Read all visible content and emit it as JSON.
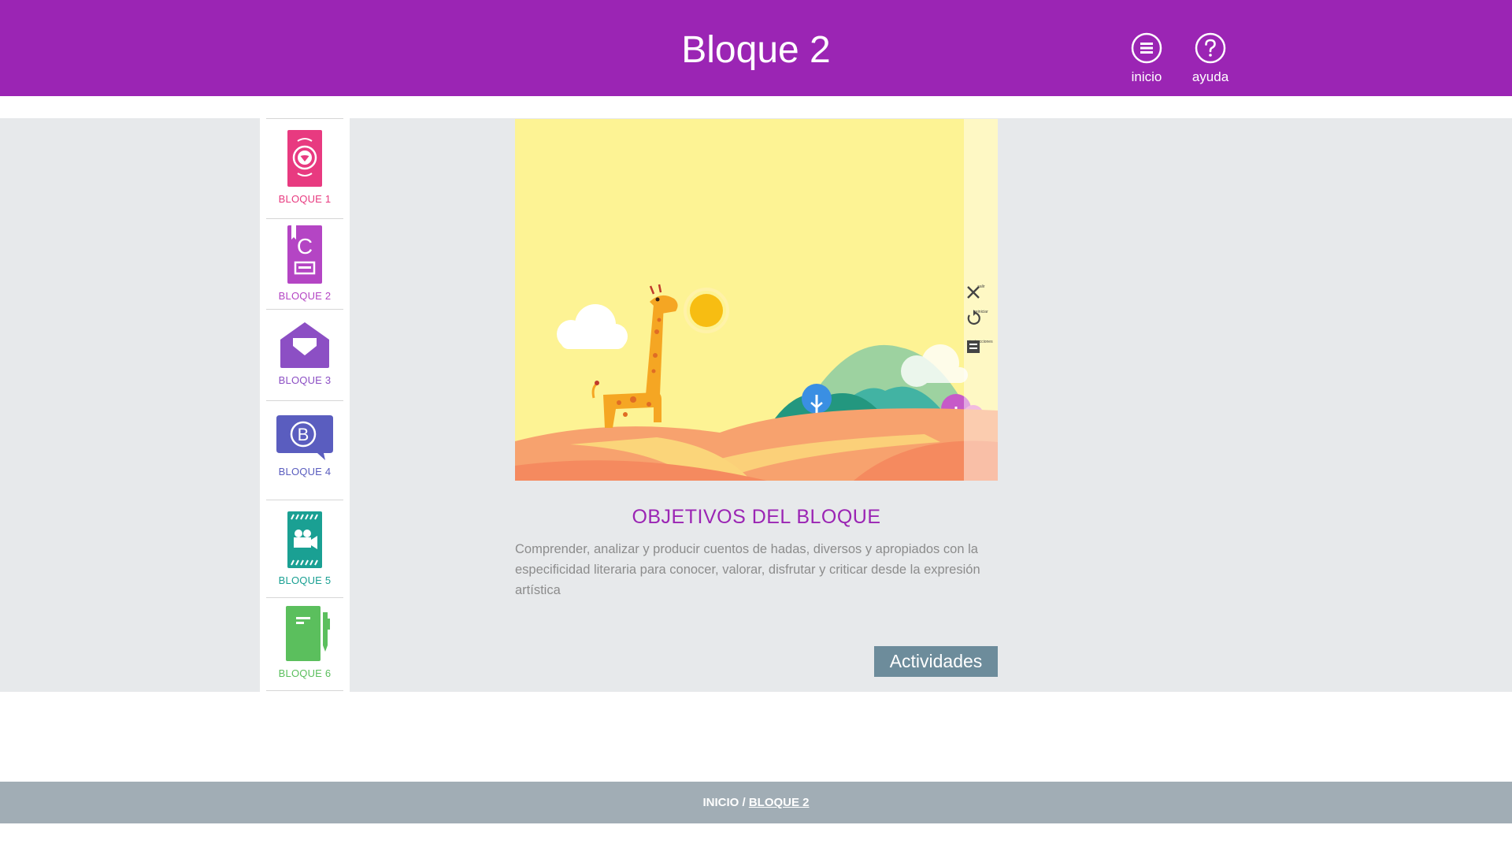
{
  "header": {
    "title": "Bloque 2",
    "nav": [
      {
        "label": "inicio",
        "icon": "menu-icon"
      },
      {
        "label": "ayuda",
        "icon": "help-icon"
      }
    ]
  },
  "sidebar": {
    "items": [
      {
        "label": "BLOQUE 1",
        "icon": "phone-heart-icon",
        "color": "#e83a80"
      },
      {
        "label": "BLOQUE 2",
        "icon": "letter-book-icon",
        "color": "#b445c4"
      },
      {
        "label": "BLOQUE 3",
        "icon": "envelope-heart-icon",
        "color": "#8c4fc4"
      },
      {
        "label": "BLOQUE 4",
        "icon": "chat-bubble-b-icon",
        "color": "#5a5dbf"
      },
      {
        "label": "BLOQUE 5",
        "icon": "film-camera-icon",
        "color": "#1aa093"
      },
      {
        "label": "BLOQUE 6",
        "icon": "notebook-pen-icon",
        "color": "#5bbf5d"
      }
    ]
  },
  "illustration": {
    "controls": [
      {
        "label": "salir",
        "icon": "close-icon"
      },
      {
        "label": "reiniciar",
        "icon": "restart-icon"
      },
      {
        "label": "instrucciones",
        "icon": "list-icon"
      }
    ]
  },
  "objectives": {
    "title": "OBJETIVOS DEL BLOQUE",
    "text": "Comprender, analizar y producir cuentos de hadas, diversos y apropiados con la especificidad literaria para conocer, valorar, disfrutar y criticar desde la expresión artística"
  },
  "actions": {
    "activities_label": "Actividades"
  },
  "footer": {
    "home": "INICIO",
    "separator": "/",
    "current": "BLOQUE 2"
  },
  "colors": {
    "header": "#9b25b4",
    "accent_button": "#6d8c9b",
    "footer": "#a1adb5"
  }
}
